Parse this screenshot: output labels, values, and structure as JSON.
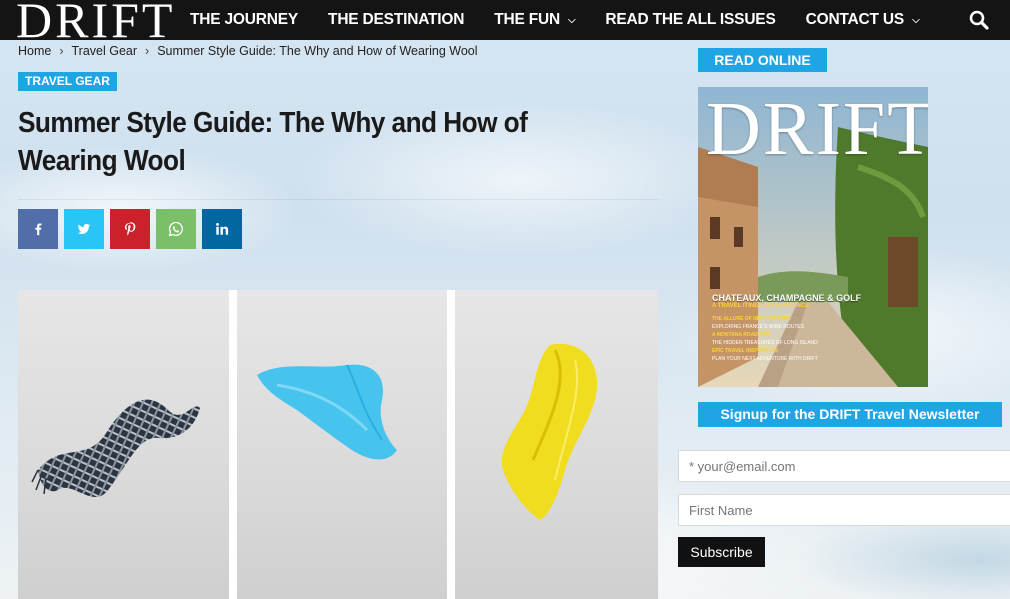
{
  "header": {
    "logo": "DRIFT",
    "nav": [
      {
        "label": "THE JOURNEY",
        "dropdown": false
      },
      {
        "label": "THE DESTINATION",
        "dropdown": false
      },
      {
        "label": "THE FUN",
        "dropdown": true
      },
      {
        "label": "READ THE ALL ISSUES",
        "dropdown": false
      },
      {
        "label": "CONTACT US",
        "dropdown": true
      }
    ],
    "search_icon": "search-icon"
  },
  "breadcrumb": [
    "Home",
    "Travel Gear",
    "Summer Style Guide: The Why and How of Wearing Wool"
  ],
  "article": {
    "category": "TRAVEL GEAR",
    "title": "Summer Style Guide: The Why and How of Wearing Wool",
    "share": [
      {
        "icon": "facebook-icon",
        "glyph": "f",
        "color": "#516eab"
      },
      {
        "icon": "twitter-icon",
        "glyph": "t",
        "color": "#29c5f6"
      },
      {
        "icon": "pinterest-icon",
        "glyph": "p",
        "color": "#ca212a"
      },
      {
        "icon": "whatsapp-icon",
        "glyph": "w",
        "color": "#7bbf6a"
      },
      {
        "icon": "linkedin-icon",
        "glyph": "in",
        "color": "#0266a0"
      }
    ]
  },
  "sidebar": {
    "read_online": "READ ONLINE",
    "cover": {
      "logo": "DRIFT",
      "headline": "CHATEAUX, CHAMPAGNE & GOLF",
      "sub": "A TRAVEL ITINERARY IN FRANCE",
      "lines": [
        "THE ALLURE OF NEW ORLEANS",
        "EXPLORING FRANCE'S WINE ROUTES",
        "A MONTANA ROAD TRIP",
        "THE HIDDEN TREASURES OF LONG ISLAND",
        "EPIC TRAVEL INSPIRATION",
        "PLAN YOUR NEXT ADVENTURE WITH DRIFT"
      ]
    },
    "newsletter": {
      "title": "Signup for the DRIFT Travel Newsletter",
      "email_placeholder": "* your@email.com",
      "name_placeholder": "First Name",
      "subscribe_label": "Subscribe"
    }
  },
  "colors": {
    "accent": "#1fa5e6",
    "header_bg": "#141414"
  }
}
